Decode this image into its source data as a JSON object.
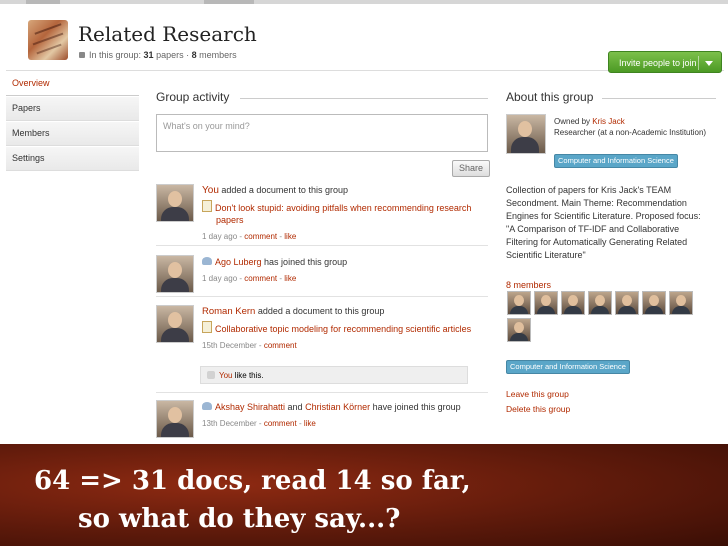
{
  "header": {
    "title": "Related Research",
    "subinfo_prefix": "In this group: ",
    "papers_count": "31",
    "papers_label": " papers",
    "dot": " · ",
    "members_count": "8",
    "members_label": " members",
    "invite_label": "Invite people to join"
  },
  "sidebar": {
    "items": [
      {
        "label": "Overview",
        "active": true
      },
      {
        "label": "Papers"
      },
      {
        "label": "Members"
      },
      {
        "label": "Settings"
      }
    ]
  },
  "activity": {
    "title": "Group activity",
    "mind_placeholder": "What's on your mind?",
    "share_label": "Share",
    "items": [
      {
        "actor": "You",
        "action": " added a document to this group",
        "doc": "Don't look stupid: avoiding pitfalls when recommending research papers",
        "when": "1 day ago",
        "dash": " - ",
        "comment": "comment",
        "sep": " - ",
        "like": "like"
      },
      {
        "actor": "Ago Luberg",
        "action": " has joined this group",
        "when": "1 day ago",
        "dash": " - ",
        "comment": "comment",
        "sep": " - ",
        "like": "like"
      },
      {
        "actor": "Roman Kern",
        "action": " added a document to this group",
        "doc": "Collaborative topic modeling for recommending scientific articles",
        "when": "15th December",
        "dash": " - ",
        "comment": "comment",
        "like_box_you": "You",
        "like_box_text": " like this."
      },
      {
        "actor1": "Akshay Shirahatti",
        "and": " and ",
        "actor2": "Christian Körner",
        "action": " have joined this group",
        "when": "13th December",
        "dash": " - ",
        "comment": "comment",
        "sep": " - ",
        "like": "like"
      }
    ]
  },
  "about": {
    "title": "About this group",
    "owned_by": "Owned by ",
    "owner": "Kris Jack",
    "owner_role": "Researcher (at a non-Academic Institution)",
    "tag": "Computer and Information Science",
    "description": "Collection of papers for Kris Jack's TEAM Secondment. Main Theme: Recommendation Engines for Scientific Literature. Proposed focus: \"A Comparison of TF-IDF and Collaborative Filtering for Automatically Generating Related Scientific Literature\"",
    "members_count": "8",
    "members_label": " members",
    "tag2": "Computer and Information Science",
    "leave": "Leave this group",
    "delete": "Delete this group"
  },
  "banner": {
    "line1": "64 => 31 docs, read 14 so far,",
    "line2": "so what do they say...?"
  },
  "colors": {
    "accent": "#b12a00",
    "invite_green": "#5fa832",
    "tag_blue": "#5aa6c8",
    "banner": "#6b1e0c"
  }
}
